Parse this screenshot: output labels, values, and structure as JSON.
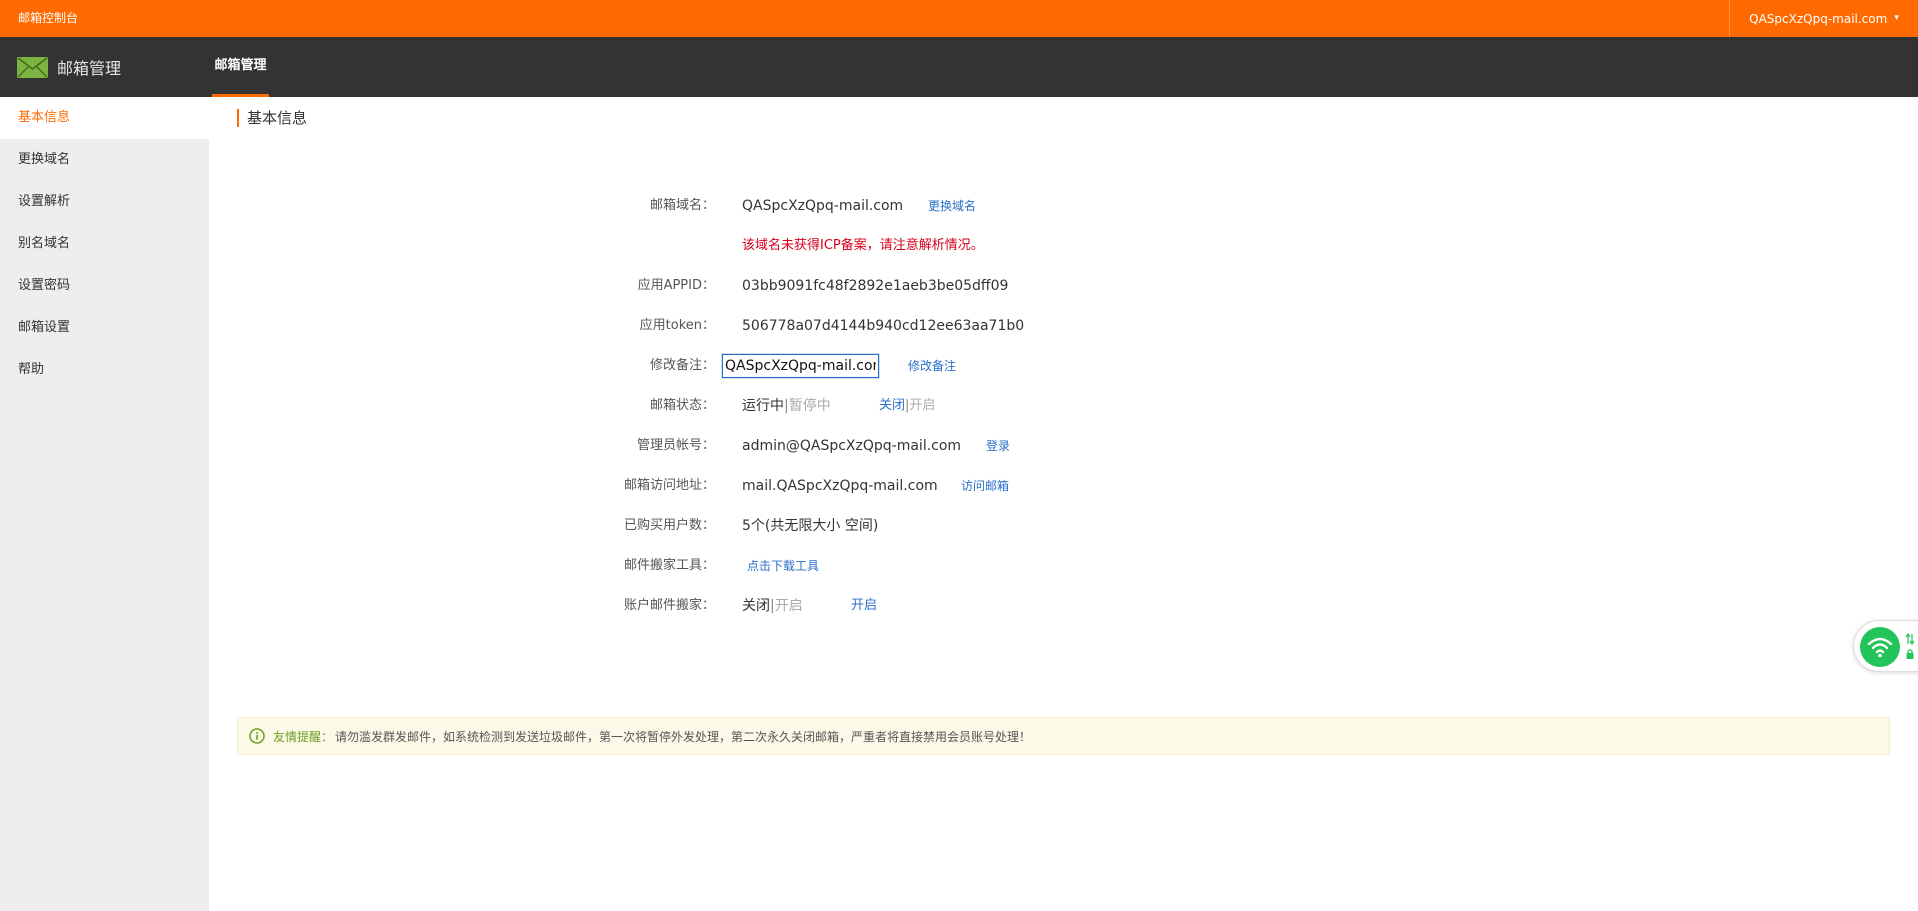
{
  "topbar": {
    "title": "邮箱控制台",
    "account": "QASpcXzQpq-mail.com",
    "caret": "▾"
  },
  "navbar": {
    "brand": "邮箱管理",
    "tab": "邮箱管理"
  },
  "sidebar": {
    "items": [
      {
        "label": "基本信息",
        "active": true
      },
      {
        "label": "更换域名"
      },
      {
        "label": "设置解析"
      },
      {
        "label": "别名域名"
      },
      {
        "label": "设置密码"
      },
      {
        "label": "邮箱设置"
      },
      {
        "label": "帮助"
      }
    ]
  },
  "main": {
    "section_title": "基本信息",
    "rows": {
      "domain": {
        "label": "邮箱域名：",
        "value": "QASpcXzQpq-mail.com",
        "link": "更换域名"
      },
      "warning": "该域名未获得ICP备案，请注意解析情况。",
      "appid": {
        "label": "应用APPID：",
        "value": "03bb9091fc48f2892e1aeb3be05dff09"
      },
      "token": {
        "label": "应用token：",
        "value": "506778a07d4144b940cd12ee63aa71b0"
      },
      "remark": {
        "label": "修改备注：",
        "input_value": "QASpcXzQpq-mail.com",
        "link": "修改备注"
      },
      "status": {
        "label": "邮箱状态：",
        "current": "运行中",
        "sep": "|",
        "other": "暂停中",
        "action_on": "关闭",
        "action_sep": "|",
        "action_off": "开启"
      },
      "admin": {
        "label": "管理员帐号：",
        "value": "admin@QASpcXzQpq-mail.com",
        "link": "登录"
      },
      "access": {
        "label": "邮箱访问地址：",
        "value": "mail.QASpcXzQpq-mail.com",
        "link": "访问邮箱"
      },
      "users": {
        "label": "已购买用户数：",
        "value": "5个(共无限大小 空间)"
      },
      "tool": {
        "label": "邮件搬家工具：",
        "link": "点击下载工具"
      },
      "migrate": {
        "label": "账户邮件搬家：",
        "current": "关闭",
        "sep": "|",
        "other": "开启",
        "action": "开启"
      }
    },
    "notice": {
      "title": "友情提醒：",
      "text": "请勿滥发群发邮件，如系统检测到发送垃圾邮件，第一次将暂停外发处理，第二次永久关闭邮箱，严重者将直接禁用会员账号处理！"
    }
  },
  "colors": {
    "accent": "#ff6a00",
    "nav_dark": "#333333",
    "link": "#2a6fc9",
    "warning": "#d6001c",
    "notice_bg": "#fdf9e8",
    "notice_title": "#6a9e1f",
    "wifi": "#23c45a"
  },
  "icons": {
    "brand": "envelope-icon",
    "notice": "info-circle-icon",
    "widget": "wifi-icon"
  }
}
